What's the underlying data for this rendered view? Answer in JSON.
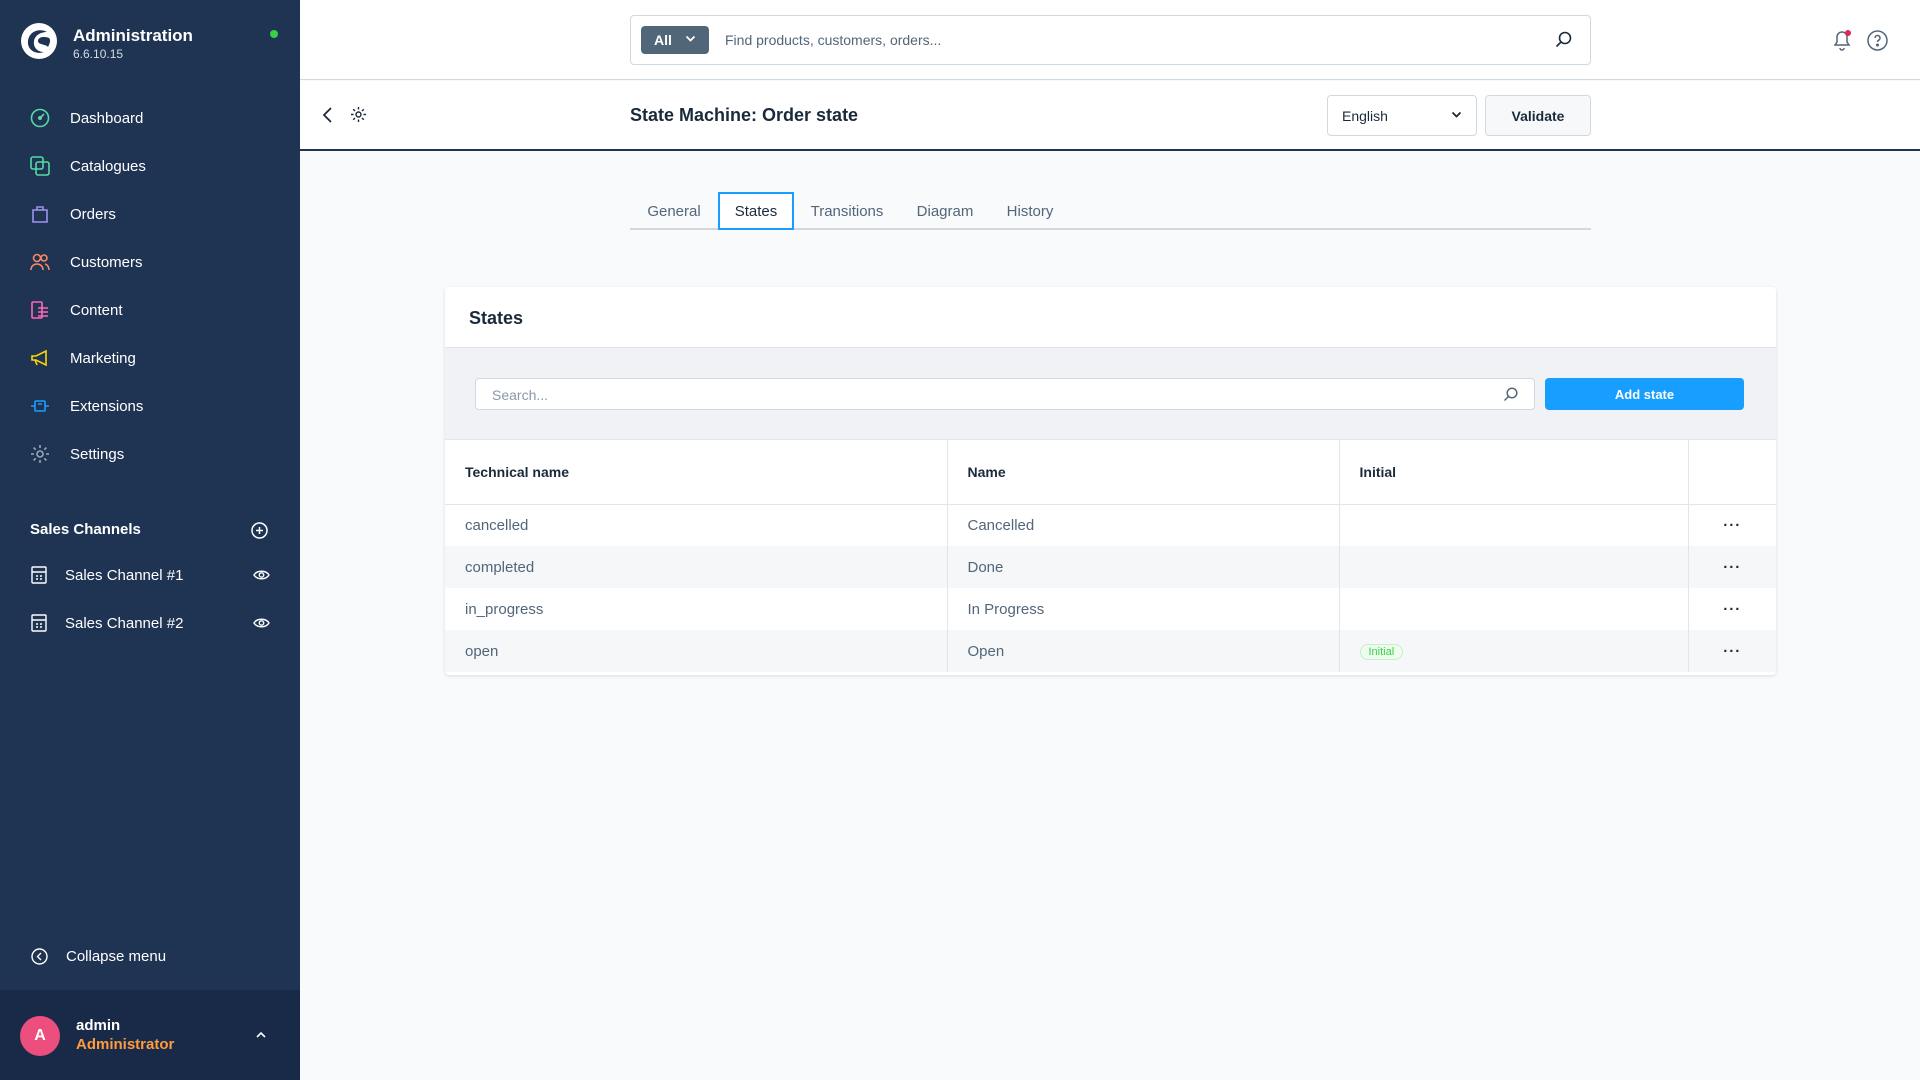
{
  "app": {
    "title": "Administration",
    "version": "6.6.10.15",
    "status_color": "#37d046"
  },
  "sidebar": {
    "nav": [
      {
        "label": "Dashboard",
        "icon": "dashboard-icon",
        "color": "#57d9a3"
      },
      {
        "label": "Catalogues",
        "icon": "catalogues-icon",
        "color": "#57d9a3"
      },
      {
        "label": "Orders",
        "icon": "orders-icon",
        "color": "#a092f0"
      },
      {
        "label": "Customers",
        "icon": "customers-icon",
        "color": "#f88962"
      },
      {
        "label": "Content",
        "icon": "content-icon",
        "color": "#ff68b4"
      },
      {
        "label": "Marketing",
        "icon": "marketing-icon",
        "color": "#ffd700"
      },
      {
        "label": "Extensions",
        "icon": "extensions-icon",
        "color": "#189eff"
      },
      {
        "label": "Settings",
        "icon": "settings-icon",
        "color": "#9aa8b5"
      }
    ],
    "sales_channels_title": "Sales Channels",
    "sales_channels": [
      {
        "label": "Sales Channel #1"
      },
      {
        "label": "Sales Channel #2"
      }
    ],
    "collapse_label": "Collapse menu",
    "user": {
      "initial": "A",
      "name": "admin",
      "role": "Administrator"
    }
  },
  "header": {
    "search_type": "All",
    "search_placeholder": "Find products, customers, orders..."
  },
  "smartbar": {
    "title": "State Machine: Order state",
    "language": "English",
    "validate_label": "Validate"
  },
  "tabs": [
    {
      "label": "General",
      "active": false
    },
    {
      "label": "States",
      "active": true
    },
    {
      "label": "Transitions",
      "active": false
    },
    {
      "label": "Diagram",
      "active": false
    },
    {
      "label": "History",
      "active": false
    }
  ],
  "states_card": {
    "title": "States",
    "search_placeholder": "Search...",
    "add_label": "Add state",
    "columns": [
      "Technical name",
      "Name",
      "Initial"
    ],
    "rows": [
      {
        "technical_name": "cancelled",
        "name": "Cancelled",
        "initial": ""
      },
      {
        "technical_name": "completed",
        "name": "Done",
        "initial": ""
      },
      {
        "technical_name": "in_progress",
        "name": "In Progress",
        "initial": ""
      },
      {
        "technical_name": "open",
        "name": "Open",
        "initial": "Initial"
      }
    ],
    "row_actions": "···"
  },
  "colors": {
    "sidebar_bg": "#1f3353",
    "primary": "#189eff",
    "notification_dot": "#de294c"
  }
}
